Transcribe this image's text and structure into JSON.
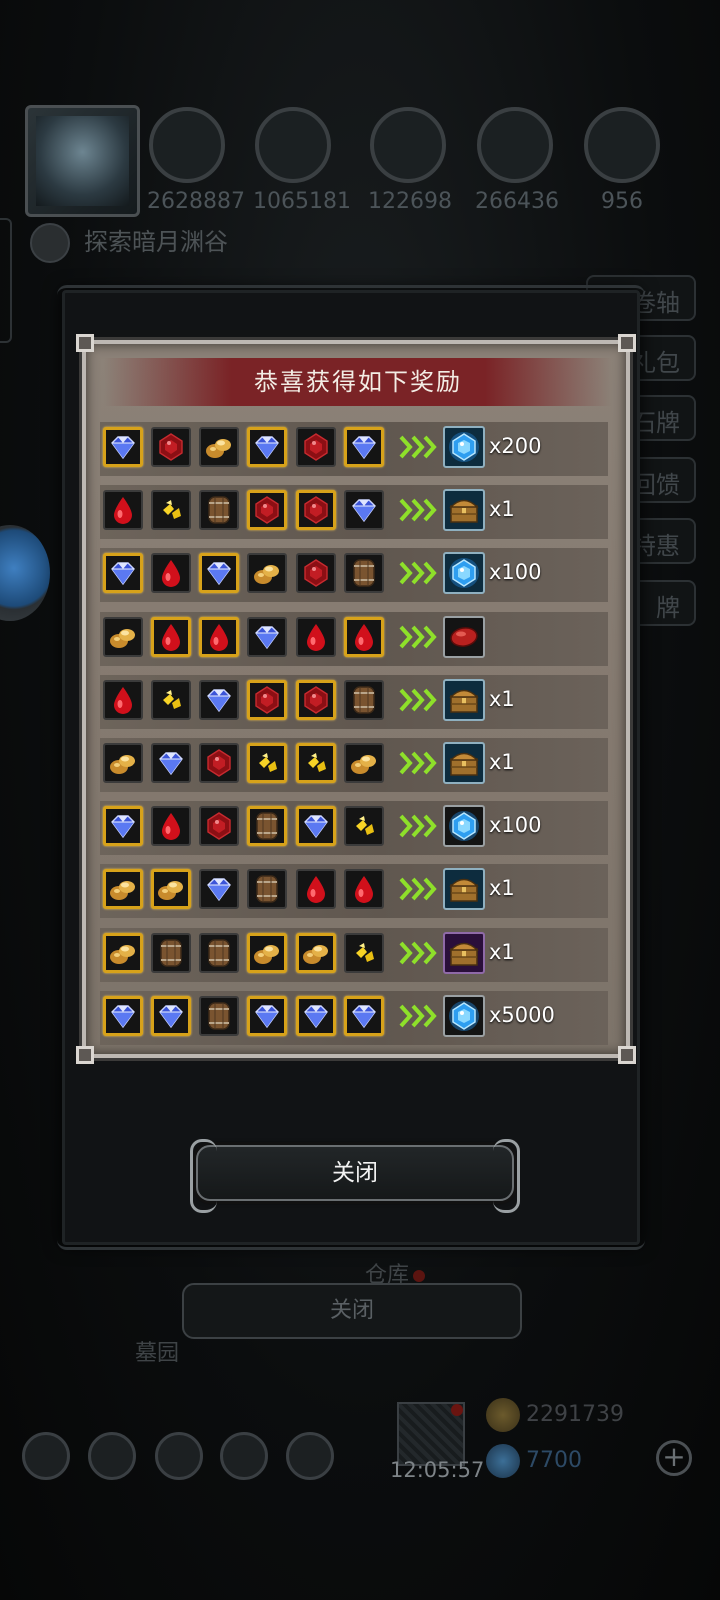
{
  "background": {
    "resources": [
      {
        "icon": "meat-icon",
        "value": "2628887"
      },
      {
        "icon": "wood-icon",
        "value": "1065181"
      },
      {
        "icon": "iron-icon",
        "value": "122698"
      },
      {
        "icon": "crystal-icon",
        "value": "266436"
      },
      {
        "icon": "ore-icon",
        "value": "956"
      }
    ],
    "explore_text": "探索暗月渊谷",
    "side_tabs": [
      "卷轴",
      "礼包",
      "石牌",
      "回馈",
      "特惠",
      "牌"
    ],
    "warehouse_label": "仓库",
    "cemetery_label": "墓园",
    "close_label": "关闭",
    "clock": "12:05:57",
    "gold": "2291739",
    "gems": "7700"
  },
  "modal": {
    "title": "恭喜获得如下奖励",
    "close_label": "关闭",
    "rows": [
      {
        "materials": [
          [
            "gem",
            "gold"
          ],
          [
            "ruby",
            "dark"
          ],
          [
            "ore",
            "dark"
          ],
          [
            "gem",
            "gold"
          ],
          [
            "ruby",
            "dark"
          ],
          [
            "gem",
            "gold"
          ]
        ],
        "reward": "blue-crystal",
        "reward_frame": "blue-frame",
        "qty": "x200"
      },
      {
        "materials": [
          [
            "blood",
            "dark"
          ],
          [
            "nugget",
            "dark"
          ],
          [
            "barrel",
            "dark"
          ],
          [
            "ruby",
            "gold"
          ],
          [
            "ruby",
            "gold"
          ],
          [
            "gem",
            "dark"
          ]
        ],
        "reward": "chest",
        "reward_frame": "blue-frame",
        "qty": "x1"
      },
      {
        "materials": [
          [
            "gem",
            "gold"
          ],
          [
            "blood",
            "dark"
          ],
          [
            "gem",
            "gold"
          ],
          [
            "ore",
            "dark"
          ],
          [
            "ruby",
            "dark"
          ],
          [
            "barrel",
            "dark"
          ]
        ],
        "reward": "blue-crystal",
        "reward_frame": "blue-frame",
        "qty": "x100"
      },
      {
        "materials": [
          [
            "ore",
            "dark"
          ],
          [
            "blood",
            "gold"
          ],
          [
            "blood",
            "gold"
          ],
          [
            "gem",
            "dark"
          ],
          [
            "blood",
            "dark"
          ],
          [
            "blood",
            "gold"
          ]
        ],
        "reward": "meat",
        "reward_frame": "dark-frame",
        "qty": ""
      },
      {
        "materials": [
          [
            "blood",
            "dark"
          ],
          [
            "nugget",
            "dark"
          ],
          [
            "gem",
            "dark"
          ],
          [
            "ruby",
            "gold"
          ],
          [
            "ruby",
            "gold"
          ],
          [
            "barrel",
            "dark"
          ]
        ],
        "reward": "chest",
        "reward_frame": "blue-frame",
        "qty": "x1"
      },
      {
        "materials": [
          [
            "ore",
            "dark"
          ],
          [
            "gem",
            "dark"
          ],
          [
            "ruby",
            "dark"
          ],
          [
            "nugget",
            "gold"
          ],
          [
            "nugget",
            "gold"
          ],
          [
            "ore",
            "dark"
          ]
        ],
        "reward": "chest",
        "reward_frame": "blue-frame",
        "qty": "x1"
      },
      {
        "materials": [
          [
            "gem",
            "gold"
          ],
          [
            "blood",
            "dark"
          ],
          [
            "ruby",
            "dark"
          ],
          [
            "barrel",
            "gold"
          ],
          [
            "gem",
            "gold"
          ],
          [
            "nugget",
            "dark"
          ]
        ],
        "reward": "blue-crystal",
        "reward_frame": "dark-frame",
        "qty": "x100"
      },
      {
        "materials": [
          [
            "ore",
            "gold"
          ],
          [
            "ore",
            "gold"
          ],
          [
            "gem",
            "dark"
          ],
          [
            "barrel",
            "dark"
          ],
          [
            "blood",
            "dark"
          ],
          [
            "blood",
            "dark"
          ]
        ],
        "reward": "chest",
        "reward_frame": "blue-frame",
        "qty": "x1"
      },
      {
        "materials": [
          [
            "ore",
            "gold"
          ],
          [
            "barrel",
            "dark"
          ],
          [
            "barrel",
            "dark"
          ],
          [
            "ore",
            "gold"
          ],
          [
            "ore",
            "gold"
          ],
          [
            "nugget",
            "dark"
          ]
        ],
        "reward": "chest",
        "reward_frame": "purple-frame",
        "qty": "x1"
      },
      {
        "materials": [
          [
            "gem",
            "gold"
          ],
          [
            "gem",
            "gold"
          ],
          [
            "barrel",
            "dark"
          ],
          [
            "gem",
            "gold"
          ],
          [
            "gem",
            "gold"
          ],
          [
            "gem",
            "gold"
          ]
        ],
        "reward": "blue-crystal",
        "reward_frame": "dark-frame",
        "qty": "x5000"
      }
    ]
  }
}
